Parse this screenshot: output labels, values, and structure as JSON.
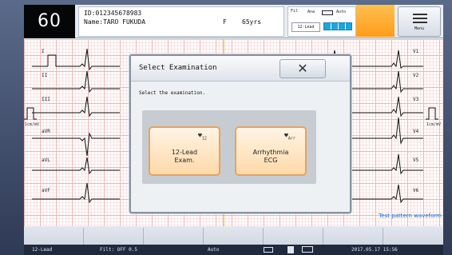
{
  "header": {
    "heart_rate": "60",
    "patient_id": "ID:012345678983",
    "patient_name": "Name:TARO FUKUDA",
    "sex": "F",
    "age": "65yrs",
    "status_icons": [
      "Fil",
      "Ana",
      "Auto"
    ],
    "mode": "12-Lead",
    "menu_label": "Menu"
  },
  "leads_left": [
    "I",
    "II",
    "III",
    "aVR",
    "aVL",
    "aVF"
  ],
  "leads_right": [
    "V1",
    "V2",
    "V3",
    "V4",
    "V5",
    "V6"
  ],
  "calibration": [
    "1cm/mV",
    "1cm/mV"
  ],
  "pattern_note": "Test pattern waveform",
  "modal": {
    "title": "Select Examination",
    "close_glyph": "✕",
    "message": "Select the examination.",
    "buttons": [
      {
        "label_line1": "12-Lead",
        "label_line2": "Exam.",
        "badge": "12"
      },
      {
        "label_line1": "Arrhythmia",
        "label_line2": "ECG",
        "badge": "Arr"
      }
    ]
  },
  "status_bar": {
    "mode": "12-Lead",
    "filter": "Filt: OFF 0.5",
    "auto": "Auto",
    "timestamp": "2017.05.17 15:56"
  },
  "colors": {
    "grid_major": "#f1b4b4",
    "grid_minor": "#fae3e3",
    "button_border": "#e8a25c",
    "orange_indicator": "#ff9d1a"
  }
}
